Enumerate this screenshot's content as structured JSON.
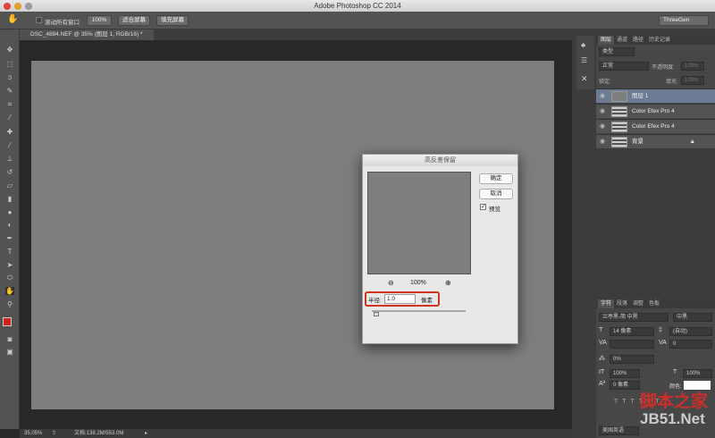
{
  "window": {
    "title": "Adobe Photoshop CC 2014"
  },
  "options_bar": {
    "scroll_all_label": "滚动所有窗口",
    "btn_100": "100%",
    "btn_fit": "适合屏幕",
    "btn_fill": "填充屏幕",
    "workspace": "ThreeGen"
  },
  "document": {
    "tab": "DSC_4884.NEF @ 35% (图层 1, RGB/16) *"
  },
  "status": {
    "zoom": "35.05%",
    "doc_size": "文档:138.2M/553.0M"
  },
  "layers_panel": {
    "tabs": [
      "图层",
      "通道",
      "路径",
      "历史记录"
    ],
    "filter": "类型",
    "blend_mode": "正常",
    "opacity_label": "不透明度:",
    "opacity": "100%",
    "lock_label": "锁定:",
    "fill_label": "填充:",
    "fill": "100%",
    "layers": [
      {
        "name": "图层 1",
        "selected": true
      },
      {
        "name": "Color Efex Pro 4"
      },
      {
        "name": "Color Efex Pro 4"
      },
      {
        "name": "背景",
        "locked": true
      }
    ]
  },
  "character_panel": {
    "tabs": [
      "字符",
      "段落",
      "调整",
      "色板"
    ],
    "font_family": "兰亭黑-简 中黑",
    "font_style": "中黑",
    "size": "14 像素",
    "leading": "(自动)",
    "kerning": "",
    "tracking": "0",
    "scale_tsume": "0%",
    "vscale": "100%",
    "hscale": "100%",
    "baseline": "0 像素",
    "color_label": "颜色:",
    "language": "美国英语"
  },
  "dialog": {
    "title": "高反差保留",
    "ok": "确定",
    "cancel": "取消",
    "preview_label": "预览",
    "preview_checked": true,
    "zoom": "100%",
    "radius_label": "半径:",
    "radius": "1.0",
    "unit": "像素"
  },
  "watermark": {
    "line1": "脚本之家",
    "line2": "JB51.Net"
  },
  "colors": {
    "foreground": "#d0231a",
    "background": "#ffffff",
    "highlight": "#d0331f",
    "selected_layer": "#6d7b95"
  }
}
